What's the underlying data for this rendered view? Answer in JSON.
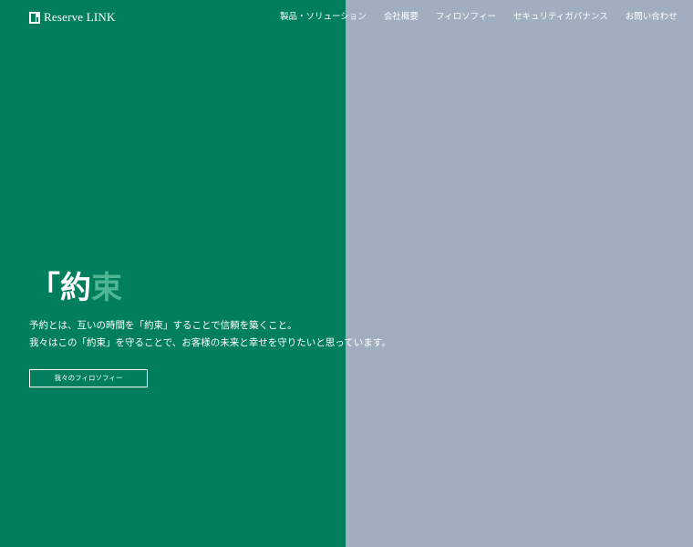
{
  "brand": {
    "name": "Reserve LINK",
    "logo_icon": "book-icon"
  },
  "nav": {
    "items": [
      {
        "label": "製品・ソリューション"
      },
      {
        "label": "会社概要"
      },
      {
        "label": "フィロソフィー"
      },
      {
        "label": "セキュリティガバナンス"
      },
      {
        "label": "お問い合わせ"
      }
    ]
  },
  "hero": {
    "headline_part1": "「約",
    "headline_part2": "束",
    "description_line1": "予約とは、互いの時間を「約束」することで信頼を築くこと。",
    "description_line2": "我々はこの「約束」を守ることで、お客様の未来と幸せを守りたいと思っています。",
    "cta_label": "我々のフィロソフィー"
  },
  "colors": {
    "left_panel": "#017e5e",
    "right_panel": "#a0aec0",
    "headline_accent": "#4fb595",
    "text": "#ffffff"
  }
}
